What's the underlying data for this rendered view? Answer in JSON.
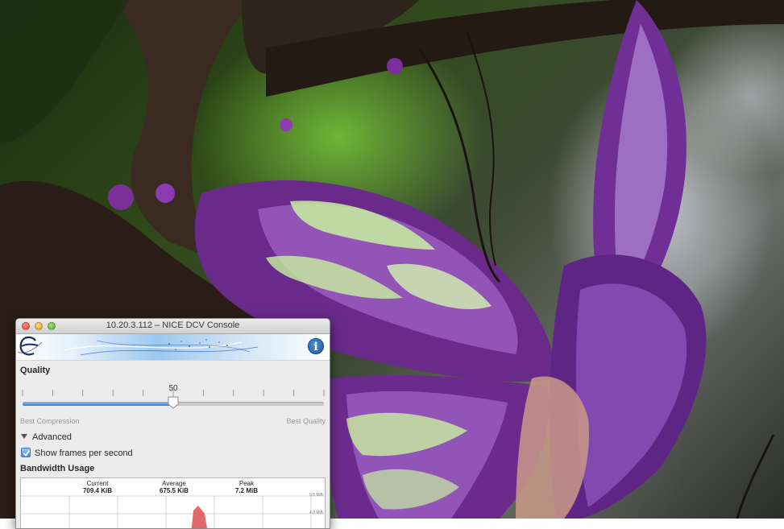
{
  "window": {
    "title": "10.20.3.112 – NICE DCV Console"
  },
  "banner": {
    "logo_icon": "nice-e-logo-icon",
    "info_icon": "info-icon",
    "info_glyph": "i"
  },
  "quality": {
    "label": "Quality",
    "value": 50,
    "value_text": "50",
    "min_label": "Best Compression",
    "max_label": "Best Quality",
    "min": 0,
    "max": 100
  },
  "advanced": {
    "label": "Advanced",
    "show_fps_label": "Show frames per second",
    "show_fps_checked": true
  },
  "bandwidth": {
    "label": "Bandwidth Usage",
    "current_label": "Current",
    "current_value": "709.4 KiB",
    "average_label": "Average",
    "average_value": "675.5 KiB",
    "peak_label": "Peak",
    "peak_value": "7.2 MiB",
    "scale_top": "9.5 MiB",
    "scale_mid": "4.8 MiB"
  },
  "colors": {
    "accent": "#3a7bcf",
    "graph_spike": "#e06a6a"
  }
}
